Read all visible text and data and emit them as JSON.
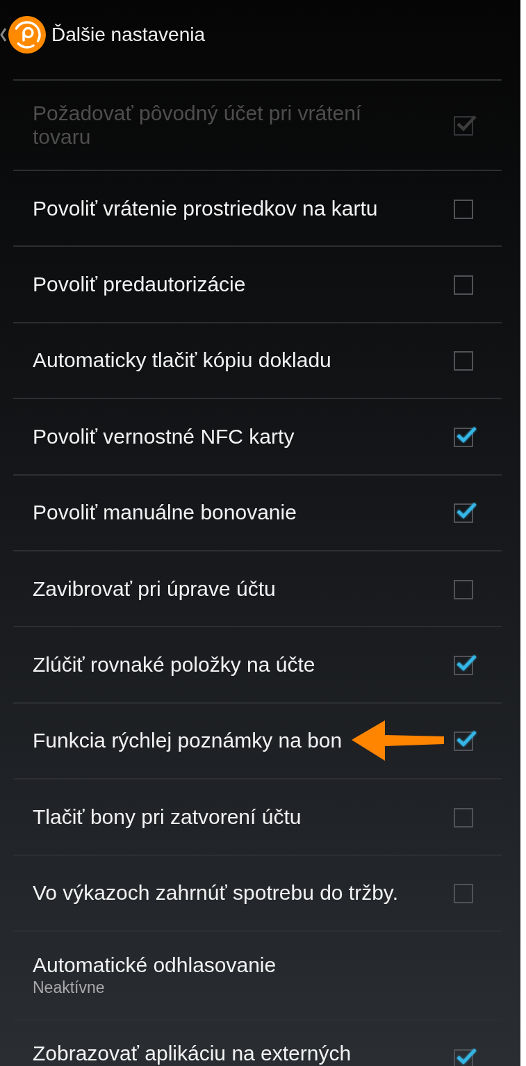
{
  "header": {
    "title": "Ďalšie nastavenia"
  },
  "rows": [
    {
      "kind": "checkbox",
      "title": "Požadovať pôvodný účet pri vrátení tovaru",
      "checked": true,
      "disabled": true,
      "arrow_annotation": false
    },
    {
      "kind": "checkbox",
      "title": "Povoliť vrátenie prostriedkov na kartu",
      "checked": false,
      "disabled": false,
      "arrow_annotation": false
    },
    {
      "kind": "checkbox",
      "title": "Povoliť predautorizácie",
      "checked": false,
      "disabled": false,
      "arrow_annotation": false
    },
    {
      "kind": "checkbox",
      "title": "Automaticky tlačiť kópiu dokladu",
      "checked": false,
      "disabled": false,
      "arrow_annotation": false
    },
    {
      "kind": "checkbox",
      "title": "Povoliť vernostné NFC karty",
      "checked": true,
      "disabled": false,
      "arrow_annotation": false
    },
    {
      "kind": "checkbox",
      "title": "Povoliť manuálne bonovanie",
      "checked": true,
      "disabled": false,
      "arrow_annotation": false
    },
    {
      "kind": "checkbox",
      "title": "Zavibrovať pri úprave účtu",
      "checked": false,
      "disabled": false,
      "arrow_annotation": false
    },
    {
      "kind": "checkbox",
      "title": "Zlúčiť rovnaké položky na účte",
      "checked": true,
      "disabled": false,
      "arrow_annotation": false
    },
    {
      "kind": "checkbox",
      "title": "Funkcia rýchlej poznámky na bon",
      "checked": true,
      "disabled": false,
      "arrow_annotation": true
    },
    {
      "kind": "checkbox",
      "title": "Tlačiť bony pri zatvorení účtu",
      "checked": false,
      "disabled": false,
      "arrow_annotation": false
    },
    {
      "kind": "checkbox",
      "title": "Vo výkazoch zahrnúť spotrebu do tržby.",
      "checked": false,
      "disabled": false,
      "arrow_annotation": false
    },
    {
      "kind": "summary",
      "title": "Automatické odhlasovanie",
      "summary": "Neaktívne",
      "disabled": false,
      "arrow_annotation": false
    },
    {
      "kind": "checkbox",
      "title": "Zobrazovať aplikáciu na externých",
      "checked": true,
      "disabled": false,
      "arrow_annotation": false
    }
  ]
}
